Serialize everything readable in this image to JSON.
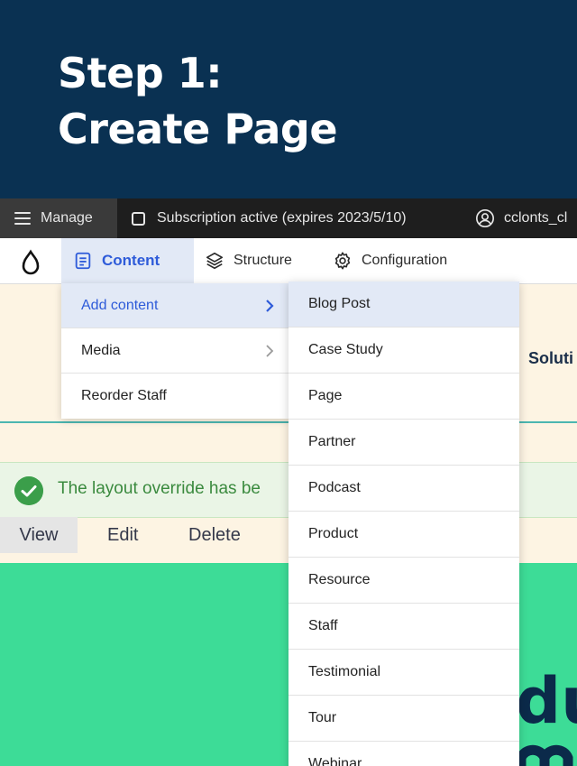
{
  "banner": {
    "line1": "Step 1:",
    "line2": "Create Page"
  },
  "toolbar": {
    "manage_label": "Manage",
    "subscription_label": "Subscription active (expires 2023/5/10)",
    "user_label": "cclonts_cl"
  },
  "admin_nav": {
    "content_label": "Content",
    "structure_label": "Structure",
    "configuration_label": "Configuration"
  },
  "content_menu": [
    {
      "label": "Add content",
      "active": true
    },
    {
      "label": "Media",
      "active": false
    },
    {
      "label": "Reorder Staff",
      "active": false
    }
  ],
  "add_content_menu": [
    "Blog Post",
    "Case Study",
    "Page",
    "Partner",
    "Podcast",
    "Product",
    "Resource",
    "Staff",
    "Testimonial",
    "Tour",
    "Webinar"
  ],
  "site_nav_partial": "Soluti",
  "status_message": "The layout override has be",
  "local_tabs": {
    "view": "View",
    "edit": "Edit",
    "delete": "Delete"
  },
  "hero_partial_text": "du",
  "colors": {
    "banner_bg": "#0a3152",
    "toolbar_bg": "#1e1e1e",
    "accent_blue": "#2e5bd9",
    "active_bg": "#e2e9f6",
    "hero_green": "#3ddc97",
    "success_green": "#3b9e4a",
    "page_bg": "#fdf4e3"
  }
}
